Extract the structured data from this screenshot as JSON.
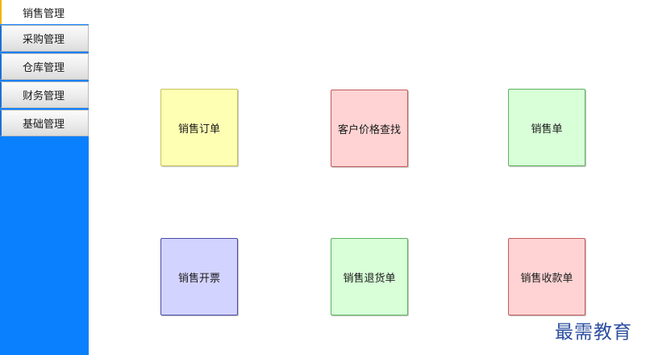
{
  "sidebar": {
    "active_item": "销售管理",
    "items": [
      "采购管理",
      "仓库管理",
      "财务管理",
      "基础管理"
    ]
  },
  "tiles": [
    {
      "label": "销售订单",
      "bg": "#ffffb3",
      "border": "#c9c35a"
    },
    {
      "label": "客户价格查找",
      "bg": "#ffd3d3",
      "border": "#c45a5a"
    },
    {
      "label": "销售单",
      "bg": "#d8ffd8",
      "border": "#5cb35c"
    },
    {
      "label": "销售开票",
      "bg": "#d3d3ff",
      "border": "#4b4ba8"
    },
    {
      "label": "销售退货单",
      "bg": "#d8ffd8",
      "border": "#5cb35c"
    },
    {
      "label": "销售收款单",
      "bg": "#ffd3d3",
      "border": "#c45a5a"
    }
  ],
  "colors": {
    "sidebar_bg": "#0a80ff",
    "active_accent": "#f0b400"
  },
  "watermark": "最需教育"
}
